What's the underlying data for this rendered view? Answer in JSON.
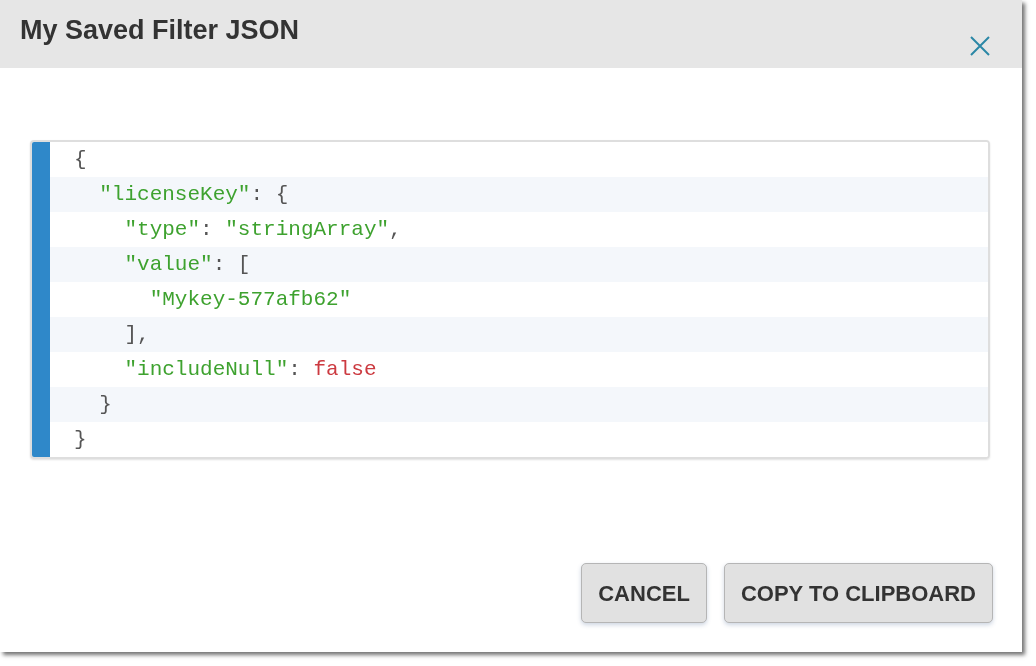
{
  "dialog": {
    "title": "My Saved Filter JSON",
    "code_lines": [
      {
        "tokens": [
          {
            "text": "{",
            "kind": "punct"
          }
        ]
      },
      {
        "tokens": [
          {
            "text": "  \"licenseKey\"",
            "kind": "string"
          },
          {
            "text": ": {",
            "kind": "punct"
          }
        ]
      },
      {
        "tokens": [
          {
            "text": "    \"type\"",
            "kind": "string"
          },
          {
            "text": ": ",
            "kind": "punct"
          },
          {
            "text": "\"stringArray\"",
            "kind": "string"
          },
          {
            "text": ",",
            "kind": "punct"
          }
        ]
      },
      {
        "tokens": [
          {
            "text": "    \"value\"",
            "kind": "string"
          },
          {
            "text": ": [",
            "kind": "punct"
          }
        ]
      },
      {
        "tokens": [
          {
            "text": "      \"Mykey-577afb62\"",
            "kind": "string"
          }
        ]
      },
      {
        "tokens": [
          {
            "text": "    ],",
            "kind": "punct"
          }
        ]
      },
      {
        "tokens": [
          {
            "text": "    \"includeNull\"",
            "kind": "string"
          },
          {
            "text": ": ",
            "kind": "punct"
          },
          {
            "text": "false",
            "kind": "literal"
          }
        ]
      },
      {
        "tokens": [
          {
            "text": "  }",
            "kind": "punct"
          }
        ]
      },
      {
        "tokens": [
          {
            "text": "}",
            "kind": "punct"
          }
        ]
      }
    ],
    "buttons": [
      "CANCEL",
      "COPY TO CLIPBOARD"
    ]
  }
}
